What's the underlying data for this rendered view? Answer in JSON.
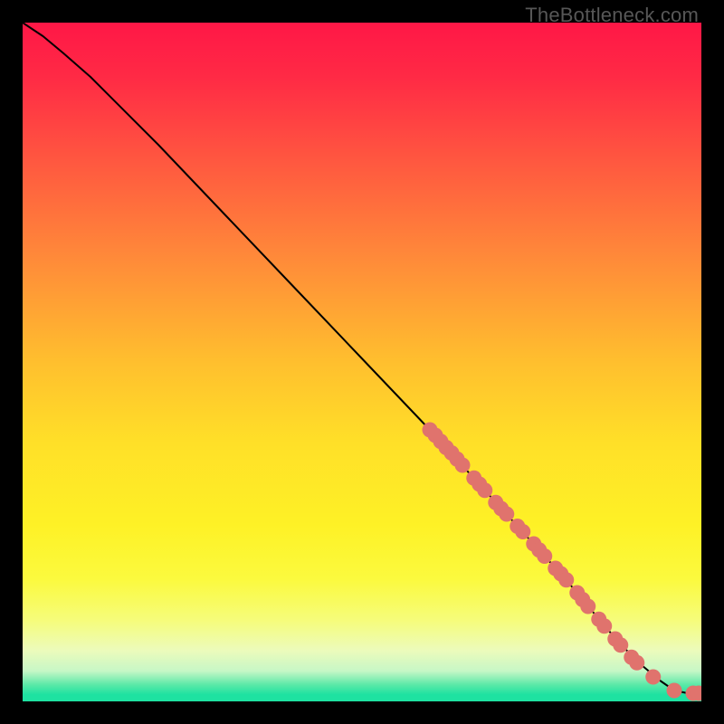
{
  "watermark": "TheBottleneck.com",
  "colors": {
    "gradient_stops": [
      {
        "offset": 0.0,
        "color": "#ff1746"
      },
      {
        "offset": 0.08,
        "color": "#ff2a45"
      },
      {
        "offset": 0.2,
        "color": "#ff5640"
      },
      {
        "offset": 0.35,
        "color": "#ff8b39"
      },
      {
        "offset": 0.5,
        "color": "#ffbf2e"
      },
      {
        "offset": 0.62,
        "color": "#ffe028"
      },
      {
        "offset": 0.74,
        "color": "#fef126"
      },
      {
        "offset": 0.82,
        "color": "#fbfa3e"
      },
      {
        "offset": 0.88,
        "color": "#f6fc7a"
      },
      {
        "offset": 0.925,
        "color": "#ecfbbb"
      },
      {
        "offset": 0.955,
        "color": "#c7f7c6"
      },
      {
        "offset": 0.975,
        "color": "#5de9a8"
      },
      {
        "offset": 0.99,
        "color": "#1ee2a1"
      },
      {
        "offset": 1.0,
        "color": "#1ee2a1"
      }
    ],
    "line": "#000000",
    "marker_fill": "#e0736d",
    "marker_stroke": "#bc5b56"
  },
  "chart_data": {
    "type": "line",
    "title": "",
    "xlabel": "",
    "ylabel": "",
    "xlim": [
      0,
      100
    ],
    "ylim": [
      0,
      100
    ],
    "grid": false,
    "legend": false,
    "series": [
      {
        "name": "curve",
        "x": [
          0,
          3,
          6,
          10,
          20,
          30,
          40,
          50,
          60,
          65,
          70,
          75,
          80,
          85,
          88,
          91,
          94,
          96,
          98,
          100
        ],
        "y": [
          100,
          98,
          95.5,
          92,
          82,
          71.5,
          61,
          50.5,
          40,
          34.5,
          29,
          23.5,
          18,
          12,
          8.5,
          5.5,
          3,
          1.6,
          1.2,
          1.2
        ]
      }
    ],
    "markers": [
      {
        "x": 60.0,
        "y": 40.0
      },
      {
        "x": 60.8,
        "y": 39.2
      },
      {
        "x": 61.6,
        "y": 38.3
      },
      {
        "x": 62.4,
        "y": 37.4
      },
      {
        "x": 63.2,
        "y": 36.6
      },
      {
        "x": 64.0,
        "y": 35.7
      },
      {
        "x": 64.8,
        "y": 34.8
      },
      {
        "x": 66.5,
        "y": 32.9
      },
      {
        "x": 67.3,
        "y": 32.0
      },
      {
        "x": 68.1,
        "y": 31.1
      },
      {
        "x": 69.7,
        "y": 29.3
      },
      {
        "x": 70.5,
        "y": 28.4
      },
      {
        "x": 71.3,
        "y": 27.6
      },
      {
        "x": 72.9,
        "y": 25.8
      },
      {
        "x": 73.7,
        "y": 25.0
      },
      {
        "x": 75.3,
        "y": 23.2
      },
      {
        "x": 76.1,
        "y": 22.3
      },
      {
        "x": 76.9,
        "y": 21.4
      },
      {
        "x": 78.5,
        "y": 19.6
      },
      {
        "x": 79.3,
        "y": 18.8
      },
      {
        "x": 80.1,
        "y": 17.9
      },
      {
        "x": 81.7,
        "y": 16.0
      },
      {
        "x": 82.5,
        "y": 15.0
      },
      {
        "x": 83.3,
        "y": 14.0
      },
      {
        "x": 84.9,
        "y": 12.1
      },
      {
        "x": 85.7,
        "y": 11.1
      },
      {
        "x": 87.3,
        "y": 9.2
      },
      {
        "x": 88.1,
        "y": 8.3
      },
      {
        "x": 89.7,
        "y": 6.5
      },
      {
        "x": 90.5,
        "y": 5.7
      },
      {
        "x": 92.9,
        "y": 3.6
      },
      {
        "x": 96.0,
        "y": 1.6
      },
      {
        "x": 98.8,
        "y": 1.2
      },
      {
        "x": 99.6,
        "y": 1.2
      }
    ]
  }
}
